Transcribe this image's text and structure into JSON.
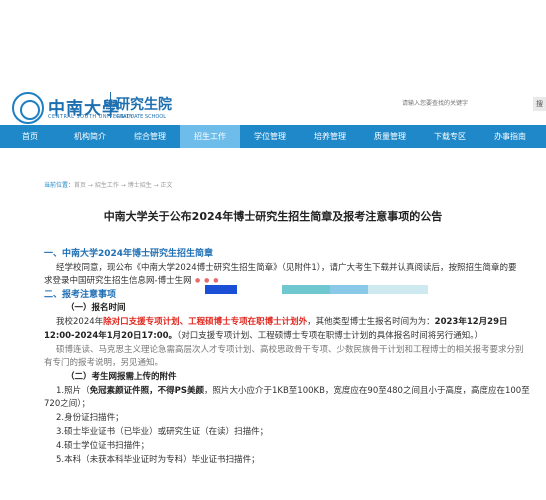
{
  "header": {
    "brand": "中南大學",
    "brand_en": "CENTRAL SOUTH UNIVERSITY",
    "department": "研究生院",
    "department_en": "GRADUATE SCHOOL",
    "search_placeholder": "请输入您要查找的关键字",
    "search_button": "搜"
  },
  "nav": {
    "items": [
      {
        "label": "首页"
      },
      {
        "label": "机构简介"
      },
      {
        "label": "综合管理"
      },
      {
        "label": "招生工作",
        "active": true
      },
      {
        "label": "学位管理"
      },
      {
        "label": "培养管理"
      },
      {
        "label": "质量管理"
      },
      {
        "label": "下载专区"
      },
      {
        "label": "办事指南"
      }
    ]
  },
  "breadcrumb": {
    "prefix": "当前位置：",
    "path": "首页 → 招生工作 → 博士招生 → 正文"
  },
  "article": {
    "title": "中南大学关于公布2024年博士研究生招生简章及报考注意事项的公告",
    "s1_heading": "一、中南大学2024年博士研究生招生简章",
    "s1_line1": "经学校同意，现公布《中南大学2024博士研究生招生简章》（见附件1），请广大考生下载并认真阅读后，按照招生简章的要",
    "s1_line2": "求登录中国研究生招生信息网-博士生网",
    "s2_heading": "二、报考注意事项",
    "s2_1_heading": "（一）报名时间",
    "s2_1_a": "我校2024年",
    "s2_1_red": "除对口支援专项计划、工程硕博士专项在职博士计划外",
    "s2_1_b": "，其他类型博士生报名时间为为：",
    "s2_1_date1": "2023年12月29日",
    "s2_1_date2": "12:00-2024年1月20日17:00。",
    "s2_1_c": "（对口支援专项计划、工程硕博士专项在职博士计划的具体报名时间将另行通知。）",
    "s2_1_line3": "硕博连读、马克思主义理论急需高层次人才专项计划、高校思政骨干专项、少数民族骨干计划和工程博士的相关报考要求分别",
    "s2_1_line4": "有专门的报考说明，另见通知。",
    "s2_2_heading": "（二）考生网报需上传的附件",
    "item1_a": "1.照片（",
    "item1_bold": "免冠素颜证件照，不得PS美颜",
    "item1_b": "，照片大小应介于1KB至100KB，宽度应在90至480之间且小于高度，高度应在100至",
    "item1_c": "720之间）；",
    "item2": "2.身份证扫描件；",
    "item3": "3.硕士毕业证书（已毕业）或研究生证（在读）扫描件；",
    "item4": "4.硕士学位证书扫描件；",
    "item5": "5.本科（未获本科毕业证时为专科）毕业证书扫描件；"
  },
  "colors": {
    "nav_bg": "#1f88c9",
    "nav_active": "#6dbcea",
    "heading_blue": "#1f6fb5",
    "highlight_red": "#e0271f"
  }
}
